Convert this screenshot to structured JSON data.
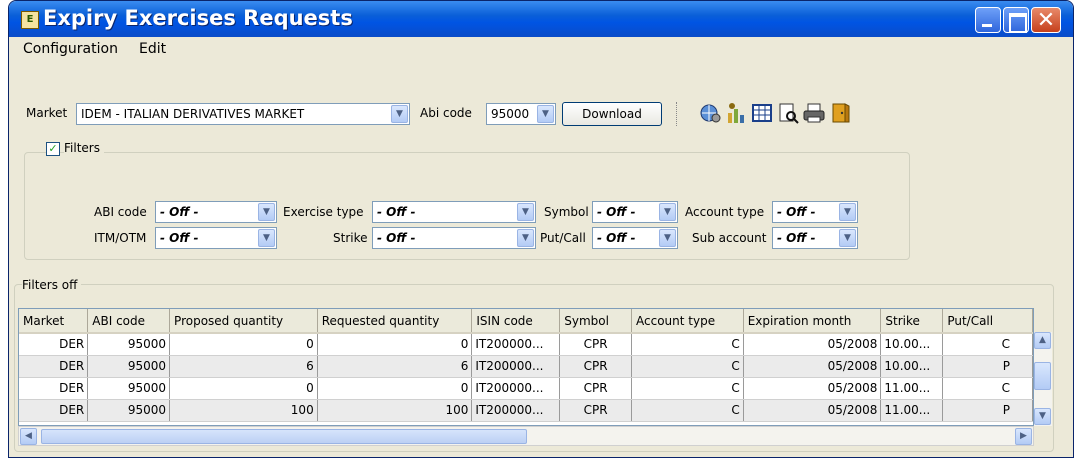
{
  "window": {
    "title": "Expiry Exercises Requests"
  },
  "menu": [
    "Configuration",
    "Edit"
  ],
  "toolbar": {
    "market_label": "Market",
    "market_value": "IDEM - ITALIAN DERIVATIVES MARKET",
    "abi_label": "Abi code",
    "abi_value": "95000",
    "download_label": "Download",
    "icons": [
      "globe-gear-icon",
      "key-chart-icon",
      "table-icon",
      "print-preview-icon",
      "printer-icon",
      "exit-door-icon"
    ]
  },
  "filters": {
    "title": "Filters",
    "checked": true,
    "abi_code_label": "ABI code",
    "abi_code_value": "- Off -",
    "exercise_type_label": "Exercise type",
    "exercise_type_value": "- Off -",
    "symbol_label": "Symbol",
    "symbol_value": "- Off -",
    "account_type_label": "Account type",
    "account_type_value": "- Off -",
    "itm_otm_label": "ITM/OTM",
    "itm_otm_value": "- Off -",
    "strike_label": "Strike",
    "strike_value": "- Off -",
    "put_call_label": "Put/Call",
    "put_call_value": "- Off -",
    "sub_account_label": "Sub account",
    "sub_account_value": "- Off -"
  },
  "grid": {
    "title": "Filters off",
    "columns": [
      "Market",
      "ABI code",
      "Proposed quantity",
      "Requested quantity",
      "ISIN code",
      "Symbol",
      "Account type",
      "Expiration month",
      "Strike",
      "Put/Call"
    ],
    "rows": [
      [
        "DER",
        "95000",
        "0",
        "0",
        "IT200000...",
        "CPR",
        "C",
        "05/2008",
        "10.00...",
        "C"
      ],
      [
        "DER",
        "95000",
        "6",
        "6",
        "IT200000...",
        "CPR",
        "C",
        "05/2008",
        "10.00...",
        "P"
      ],
      [
        "DER",
        "95000",
        "0",
        "0",
        "IT200000...",
        "CPR",
        "C",
        "05/2008",
        "11.00...",
        "C"
      ],
      [
        "DER",
        "95000",
        "100",
        "100",
        "IT200000...",
        "CPR",
        "C",
        "05/2008",
        "11.00...",
        "P"
      ]
    ]
  }
}
